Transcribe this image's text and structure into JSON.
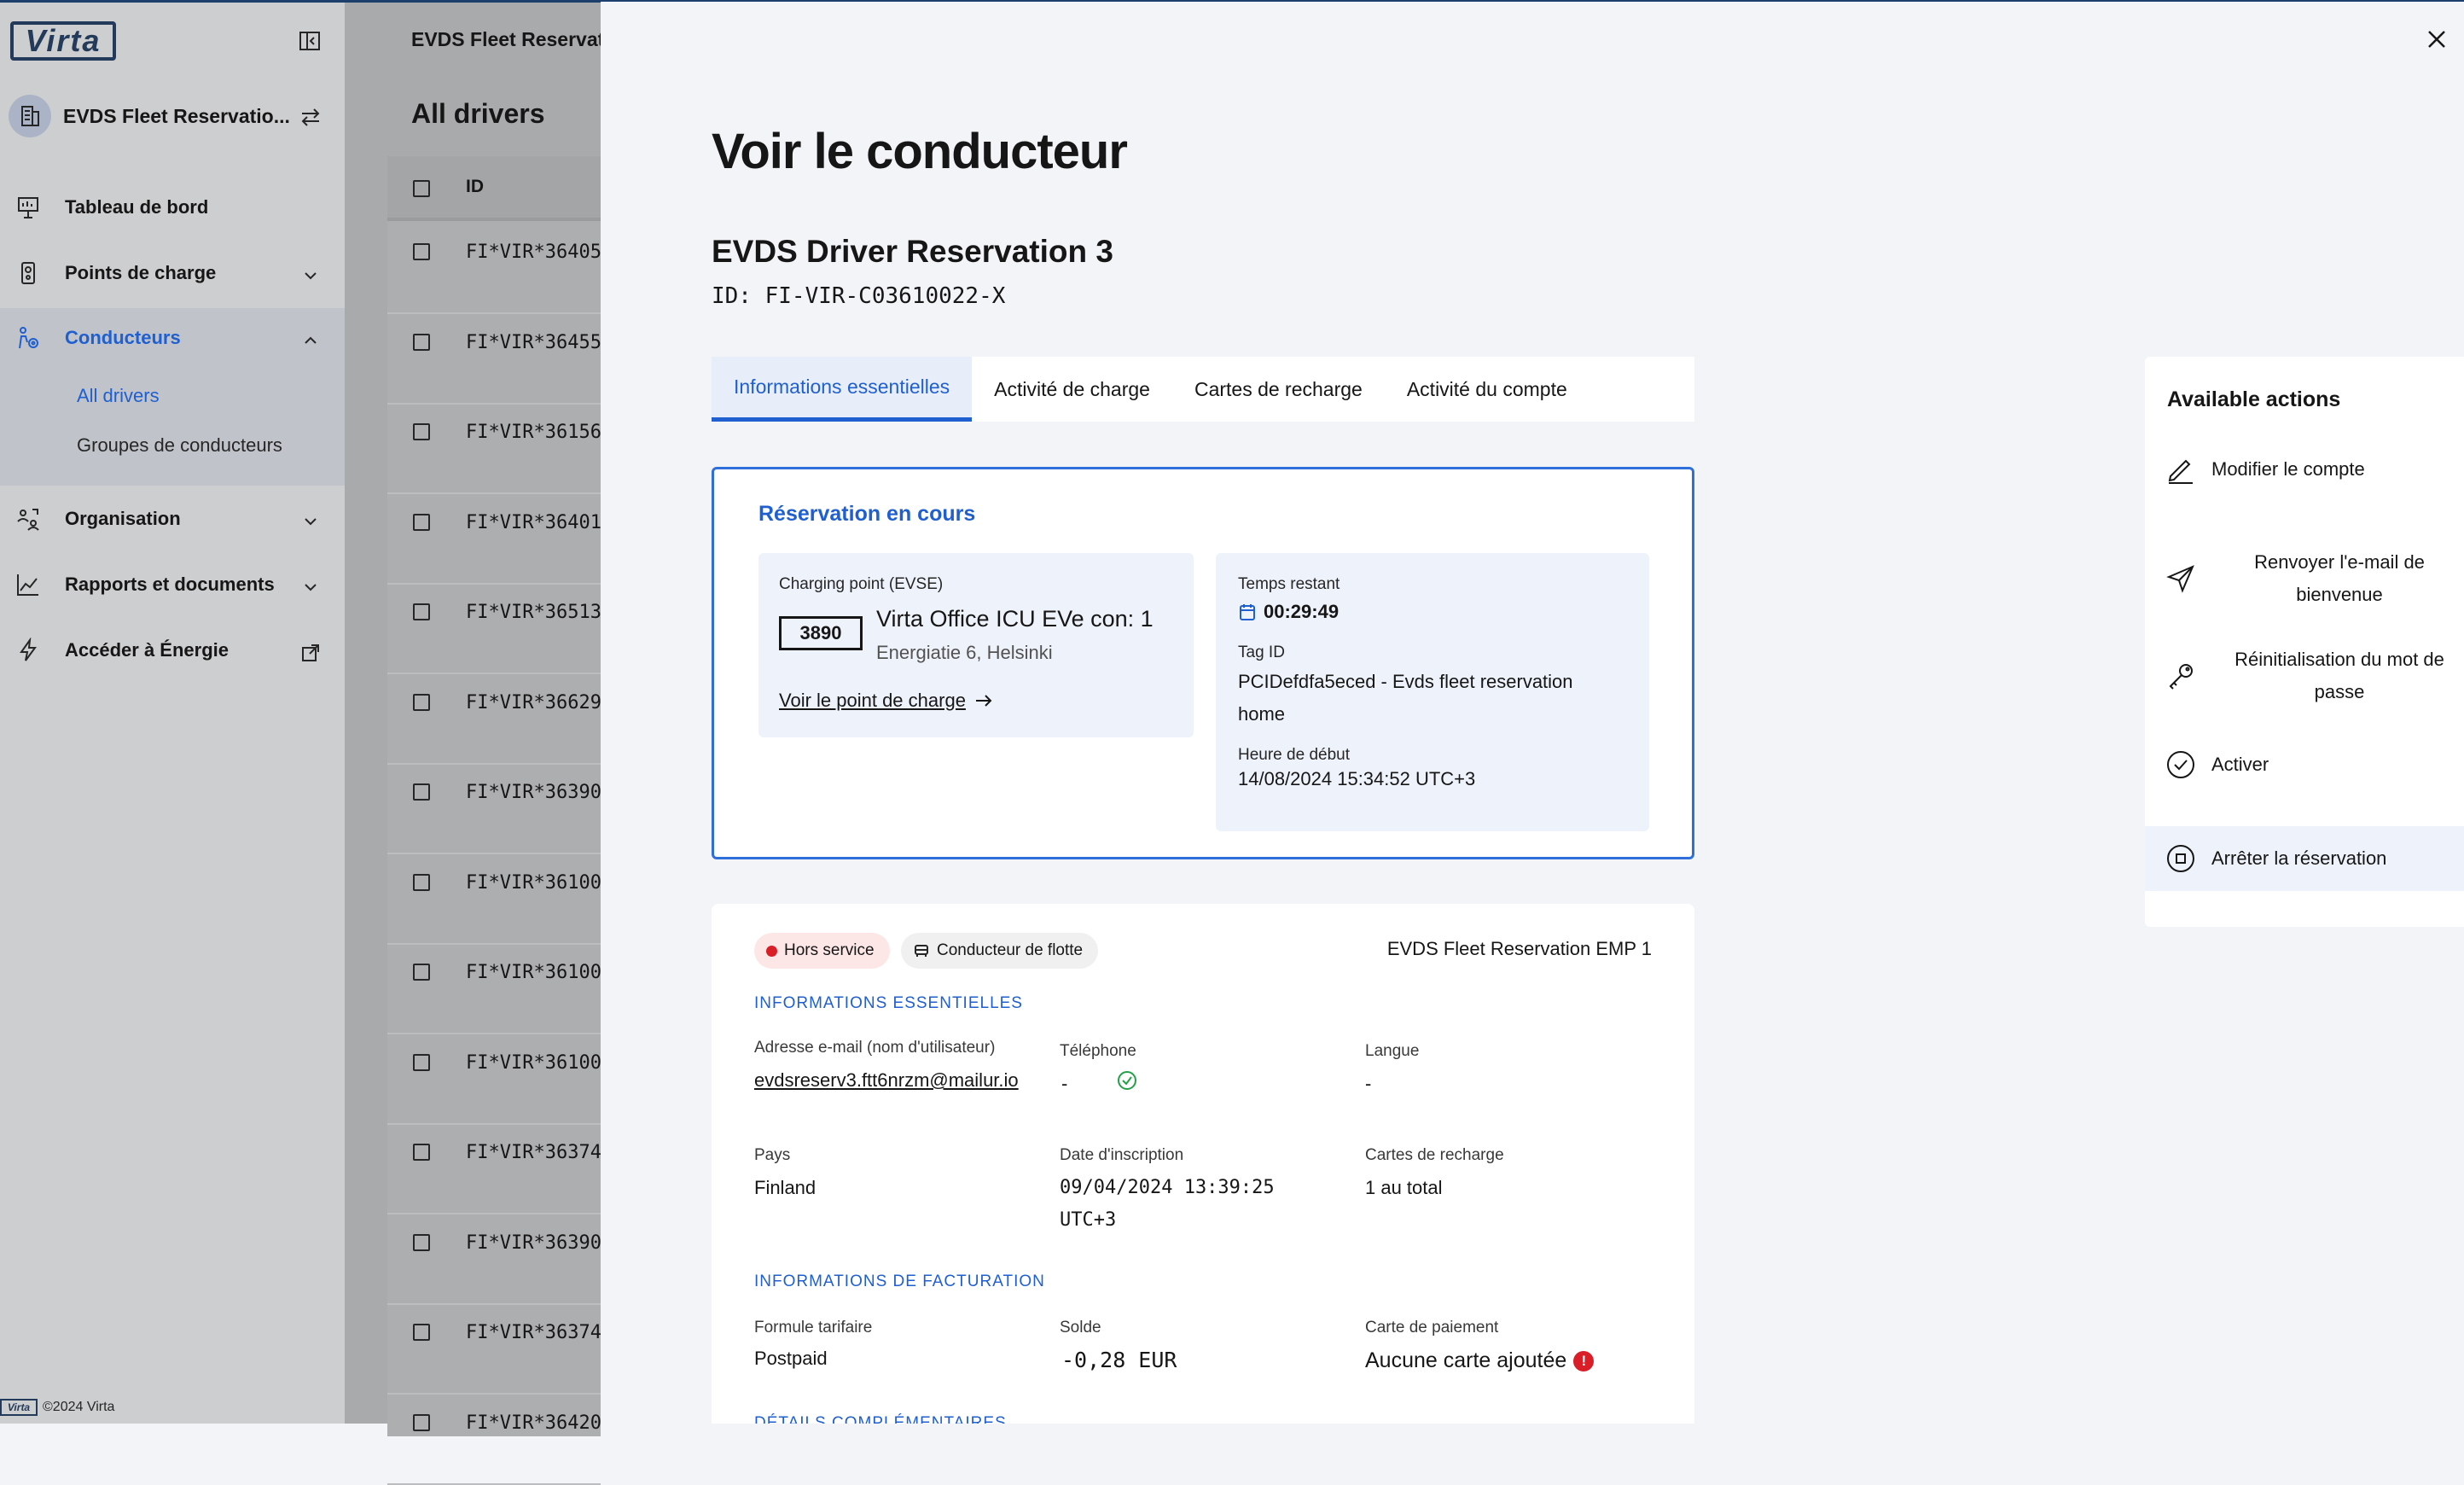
{
  "sidebar": {
    "logo": "Virta",
    "org_name": "EVDS Fleet Reservatio...",
    "nav": [
      {
        "label": "Tableau de bord"
      },
      {
        "label": "Points de charge"
      },
      {
        "label": "Conducteurs"
      },
      {
        "label": "Organisation"
      },
      {
        "label": "Rapports et documents"
      },
      {
        "label": "Accéder à Énergie"
      }
    ],
    "sub": {
      "all_drivers": "All drivers",
      "groups": "Groupes de conducteurs"
    },
    "footer_logo": "Virta",
    "footer": "©2024 Virta"
  },
  "page": {
    "title": "EVDS Fleet Reservati",
    "heading": "All drivers",
    "col_id": "ID",
    "rows": [
      "FI*VIR*36405",
      "FI*VIR*36455",
      "FI*VIR*36156",
      "FI*VIR*36401",
      "FI*VIR*36513",
      "FI*VIR*36629",
      "FI*VIR*36390",
      "FI*VIR*36100",
      "FI*VIR*36100",
      "FI*VIR*36100",
      "FI*VIR*36374",
      "FI*VIR*36390",
      "FI*VIR*36374",
      "FI*VIR*36420"
    ]
  },
  "drawer": {
    "title": "Voir le conducteur",
    "driver_name": "EVDS Driver Reservation 3",
    "driver_id": "ID: FI-VIR-C03610022-X",
    "tabs": [
      "Informations essentielles",
      "Activité de charge",
      "Cartes de recharge",
      "Activité du compte"
    ],
    "reservation": {
      "title": "Réservation en cours",
      "cp_label": "Charging point (EVSE)",
      "evse": "3890",
      "cp_name": "Virta Office ICU EVe con: 1",
      "cp_address": "Energiatie 6, Helsinki",
      "cp_link": "Voir le point de charge",
      "time_label": "Temps restant",
      "time_value": "00:29:49",
      "tag_label": "Tag ID",
      "tag_value": "PCIDefdfa5eced - Evds fleet reservation home",
      "start_label": "Heure de début",
      "start_value": "14/08/2024 15:34:52 UTC+3"
    },
    "info": {
      "status": "Hors service",
      "type": "Conducteur de flotte",
      "employer": "EVDS Fleet Reservation EMP 1",
      "section_essential": "INFORMATIONS ESSENTIELLES",
      "email_label": "Adresse e-mail (nom d'utilisateur)",
      "email": "evdsreserv3.ftt6nrzm@mailur.io",
      "phone_label": "Téléphone",
      "phone": "-",
      "lang_label": "Langue",
      "lang": "-",
      "country_label": "Pays",
      "country": "Finland",
      "signup_label": "Date d'inscription",
      "signup": "09/04/2024 13:39:25 UTC+3",
      "cards_label": "Cartes de recharge",
      "cards": "1 au total",
      "section_billing": "INFORMATIONS DE FACTURATION",
      "plan_label": "Formule tarifaire",
      "plan": "Postpaid",
      "balance_label": "Solde",
      "balance": "-0,28 EUR",
      "payment_label": "Carte de paiement",
      "payment": "Aucune carte ajoutée",
      "section_more": "DÉTAILS COMPLÉMENTAIRES"
    }
  },
  "actions": {
    "title": "Available actions",
    "items": [
      "Modifier le compte",
      "Renvoyer l'e-mail de bienvenue",
      "Réinitialisation du mot de passe",
      "Activer",
      "Arrêter la réservation"
    ]
  },
  "colors": {
    "accent": "#1f5fd0",
    "danger": "#da1e28",
    "success": "#24a148"
  }
}
